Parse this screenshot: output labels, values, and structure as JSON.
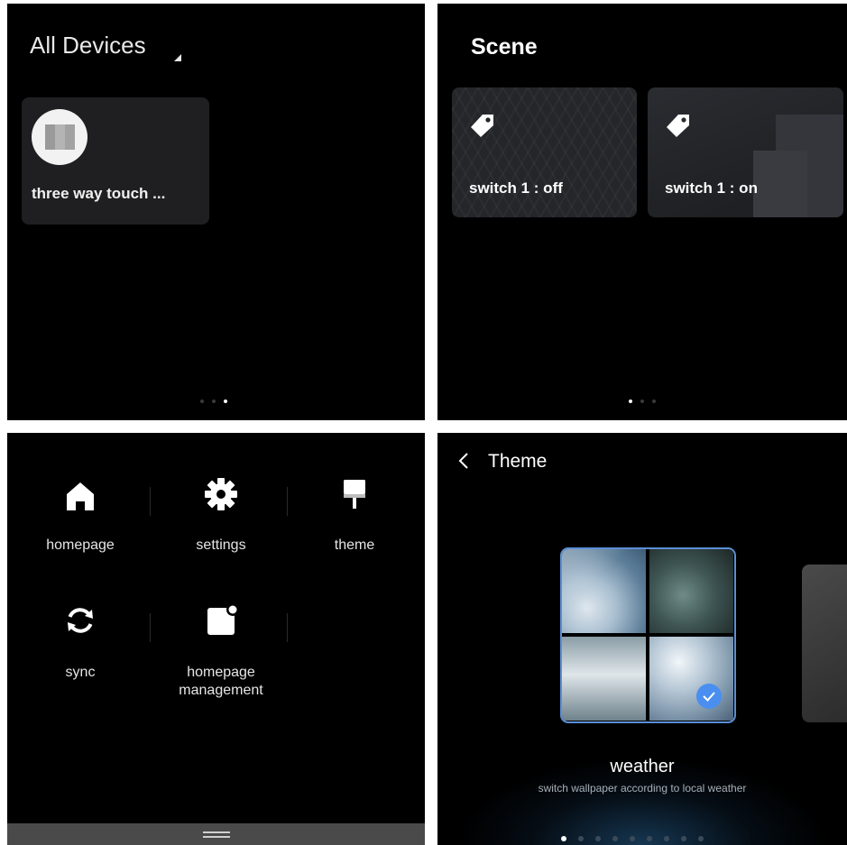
{
  "all_devices": {
    "title": "All Devices",
    "device_name": "three way touch ...",
    "pager": {
      "count": 3,
      "active": 2
    }
  },
  "scene": {
    "title": "Scene",
    "cards": [
      {
        "label": "switch 1 : off",
        "icon": "tag-icon"
      },
      {
        "label": "switch 1 : on",
        "icon": "tag-icon"
      }
    ],
    "pager": {
      "count": 3,
      "active": 0
    }
  },
  "menu": {
    "items": [
      {
        "label": "homepage",
        "icon": "home-icon"
      },
      {
        "label": "settings",
        "icon": "gear-icon"
      },
      {
        "label": "theme",
        "icon": "paint-roller-icon"
      },
      {
        "label": "sync",
        "icon": "sync-icon"
      },
      {
        "label": "homepage\nmanagement",
        "icon": "homepage-management-icon"
      }
    ]
  },
  "theme_page": {
    "title": "Theme",
    "selected_theme": {
      "name": "weather",
      "description": "switch wallpaper according to local weather"
    },
    "pager": {
      "count": 9,
      "active": 0
    },
    "colors": {
      "accent": "#4a8ff0",
      "selected_border": "#5b8fd6"
    }
  }
}
